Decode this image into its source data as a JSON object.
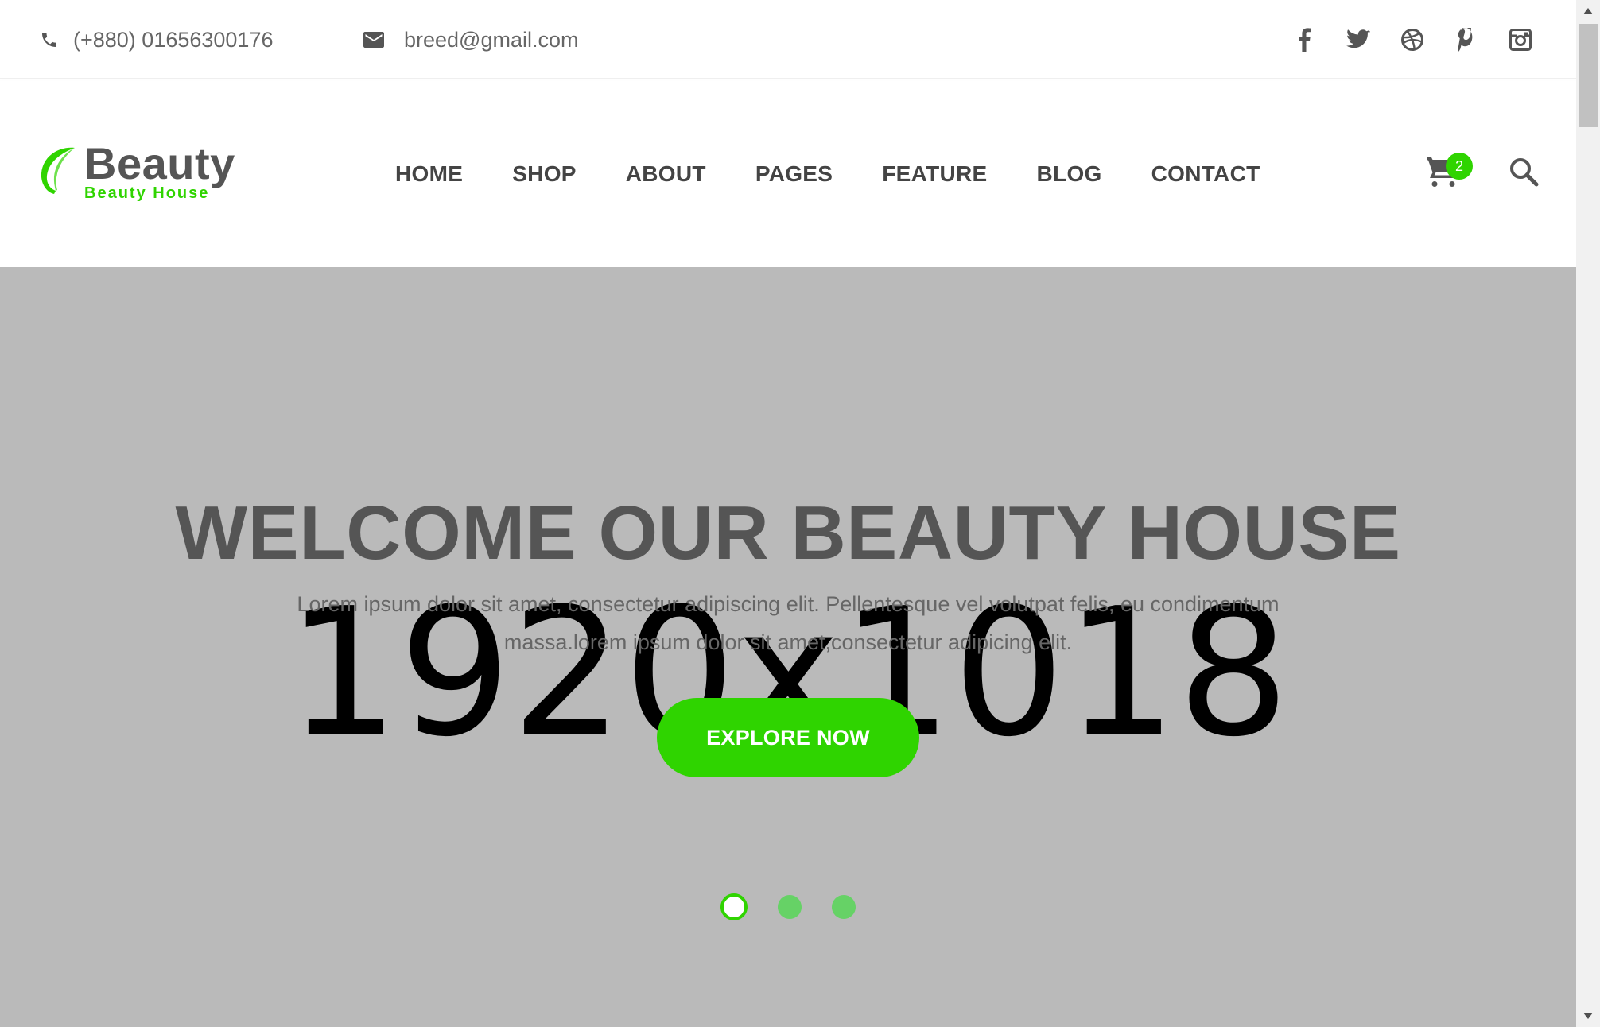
{
  "topbar": {
    "phone": "(+880) 01656300176",
    "email": "breed@gmail.com",
    "phone_icon": "phone-icon",
    "email_icon": "mail-icon",
    "socials": [
      "facebook-icon",
      "twitter-icon",
      "dribbble-icon",
      "pinterest-icon",
      "instagram-icon"
    ]
  },
  "header": {
    "logo_word": "Beauty",
    "logo_sub": "Beauty House",
    "nav": [
      "HOME",
      "SHOP",
      "ABOUT",
      "PAGES",
      "FEATURE",
      "BLOG",
      "CONTACT"
    ],
    "cart_count": "2",
    "cart_icon": "cart-icon",
    "search_icon": "search-icon"
  },
  "hero": {
    "placeholder": "1920x1018",
    "title": "WELCOME OUR BEAUTY HOUSE",
    "text": "Lorem ipsum dolor sit amet, consectetur adipiscing elit. Pellentesque vel volutpat felis, eu condimentum massa.lorem ipsum dolor sit amet,consectetur adipicing elit.",
    "button": "EXPLORE NOW",
    "slides": 3,
    "active_slide": 1
  },
  "colors": {
    "accent": "#2fd400",
    "hero_bg": "#bababa",
    "text_dark": "#555555"
  }
}
